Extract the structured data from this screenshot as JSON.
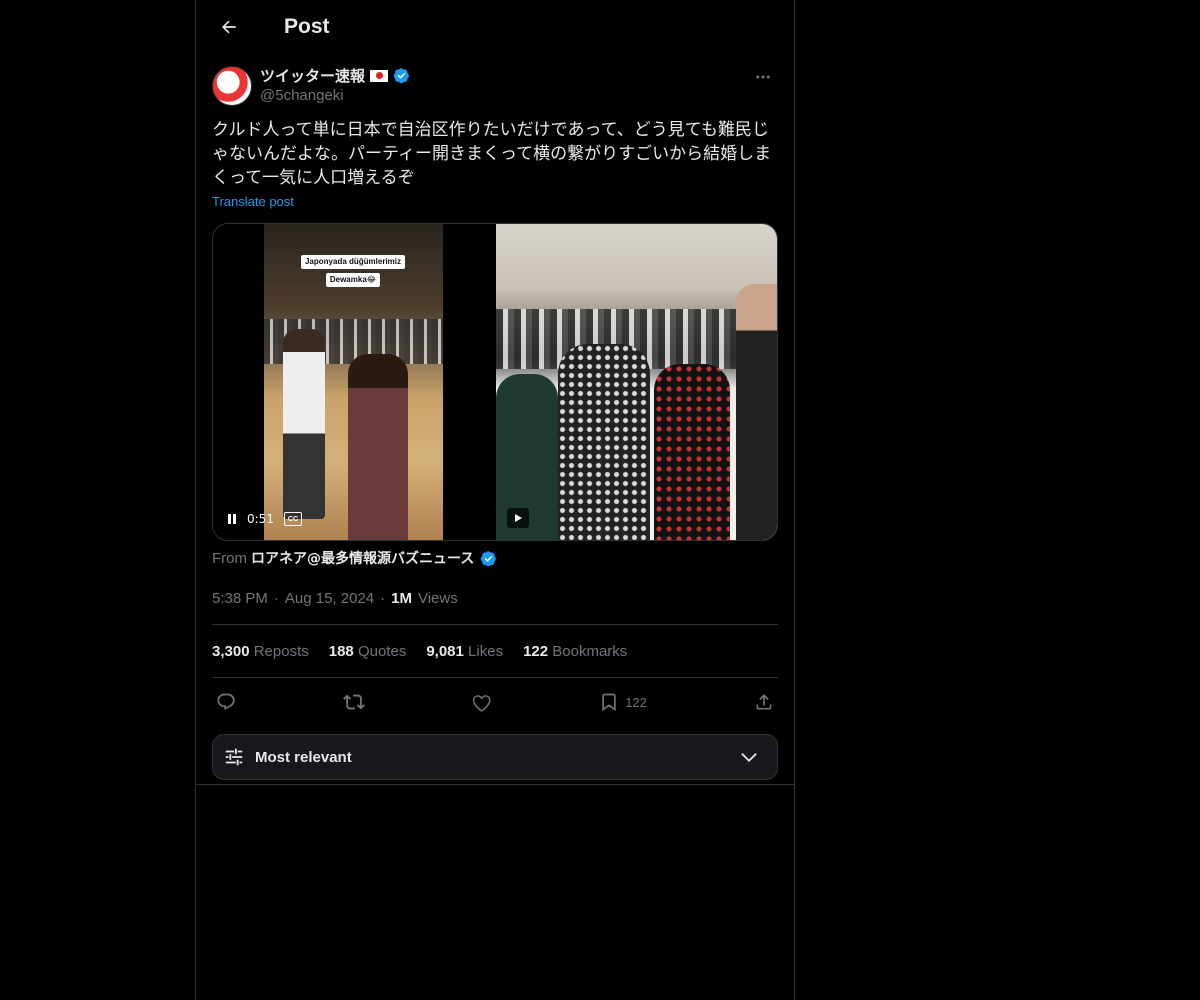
{
  "header": {
    "back_icon": "arrow-left-icon",
    "title": "Post"
  },
  "post": {
    "author": {
      "display_name": "ツイッター速報",
      "flag": "japan-flag-icon",
      "verified_icon": "verified-badge-icon",
      "handle": "@5changeki"
    },
    "more_icon": "more-horizontal-icon",
    "text": "クルド人って単に日本で自治区作りたいだけであって、どう見ても難民じゃないんだよな。パーティー開きまくって横の繋がりすごいから結婚しまくって一気に人口増えるぞ",
    "translate_label": "Translate post",
    "media": {
      "caption_line1": "Japonyada düğümlerimiz",
      "caption_line2": "Dewamka😂",
      "time": "0:51",
      "cc_label": "CC"
    },
    "from_prefix": "From",
    "from_source": "ロアネア@最多情報源バズニュース",
    "time": "5:38 PM",
    "date": "Aug 15, 2024",
    "views_count": "1M",
    "views_label": "Views"
  },
  "stats": {
    "reposts_count": "3,300",
    "reposts_label": "Reposts",
    "quotes_count": "188",
    "quotes_label": "Quotes",
    "likes_count": "9,081",
    "likes_label": "Likes",
    "bookmarks_count": "122",
    "bookmarks_label": "Bookmarks"
  },
  "actions": {
    "reply_icon": "reply-icon",
    "repost_icon": "repost-icon",
    "like_icon": "heart-icon",
    "bookmark_icon": "bookmark-icon",
    "bookmark_count": "122",
    "share_icon": "share-icon"
  },
  "sort": {
    "icon": "sliders-icon",
    "label": "Most relevant",
    "chevron": "chevron-down-icon"
  },
  "colors": {
    "accent": "#1d9bf0",
    "background": "#000000",
    "text_primary": "#e7e9ea",
    "text_secondary": "#71767b",
    "border": "#2f3336"
  }
}
